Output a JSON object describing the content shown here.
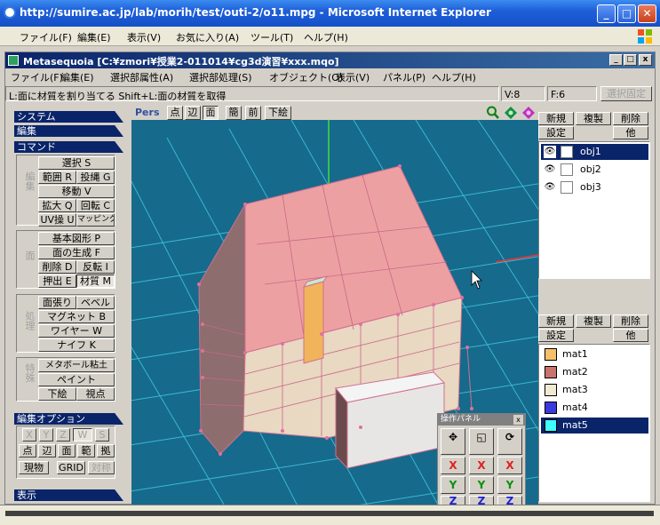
{
  "ie": {
    "title": "http://sumire.ac.jp/lab/morih/test/outi-2/o11.mpg - Microsoft Internet Explorer",
    "menu": [
      "ファイル(F)",
      "編集(E)",
      "表示(V)",
      "お気に入り(A)",
      "ツール(T)",
      "ヘルプ(H)"
    ]
  },
  "app": {
    "title": "Metasequoia [C:¥zmori¥授業2-011014¥cg3d演習¥xxx.mqo]",
    "menu": [
      "ファイル(F)",
      "編集(E)",
      "選択部属性(A)",
      "選択部処理(S)",
      "オブジェクト(O)",
      "表示(V)",
      "パネル(P)",
      "ヘルプ(H)"
    ],
    "status_hint": "L:面に材質を割り当てる  Shift+L:面の材質を取得",
    "vertex_count": "V:8",
    "face_count": "F:6",
    "lock_button": "選択固定"
  },
  "left": {
    "system": "システム",
    "edit": "編集",
    "command": "コマンド",
    "group1_label": "編集",
    "select": "選択 S",
    "range": "範囲 R",
    "lasso": "投縄 G",
    "move": "移動 V",
    "scale": "拡大 Q",
    "rotate": "回転 C",
    "uv": "UV操 U",
    "mapping": "マッピング",
    "group2_label": "面",
    "basic_shape": "基本図形 P",
    "create_face": "面の生成 F",
    "delete": "削除 D",
    "invert": "反転 I",
    "extrude": "押出 E",
    "material": "材質 M",
    "group3_label": "処理",
    "face_stretch": "面張り",
    "bevel": "ベベル",
    "magnet": "マグネット B",
    "wire": "ワイヤー W",
    "knife": "ナイフ K",
    "group4_label": "特殊",
    "metaball": "メタボール粘土",
    "paint": "ペイント",
    "underlay": "下絵",
    "viewpoint": "視点",
    "edit_option": "編集オプション",
    "axis_x": "X",
    "axis_y": "Y",
    "axis_z": "Z",
    "axis_w": "W",
    "axis_s": "S",
    "sel_point": "点",
    "sel_edge": "辺",
    "sel_face": "面",
    "sel_range": "範",
    "sel_extra": "拠",
    "current_obj": "現物",
    "grid": "GRID",
    "symmetry": "対称",
    "display": "表示"
  },
  "viewport": {
    "mode": "Pers",
    "btn_point": "点",
    "btn_edge": "辺",
    "btn_face": "面",
    "btn_simple": "簡",
    "btn_front": "前",
    "btn_underlay": "下絵"
  },
  "objects": {
    "new": "新規",
    "duplicate": "複製",
    "delete": "削除",
    "settings": "設定",
    "other": "他",
    "items": [
      "obj1",
      "obj2",
      "obj3"
    ]
  },
  "materials": {
    "new": "新規",
    "duplicate": "複製",
    "delete": "削除",
    "settings": "設定",
    "other": "他",
    "items": [
      {
        "name": "mat1",
        "color": "#f5c06a"
      },
      {
        "name": "mat2",
        "color": "#c8746c"
      },
      {
        "name": "mat3",
        "color": "#f0ead2"
      },
      {
        "name": "mat4",
        "color": "#3a3ae0"
      },
      {
        "name": "mat5",
        "color": "#40ffff"
      }
    ]
  },
  "op_panel": {
    "title": "操作パネル",
    "x": "X",
    "y": "Y",
    "z": "Z"
  }
}
